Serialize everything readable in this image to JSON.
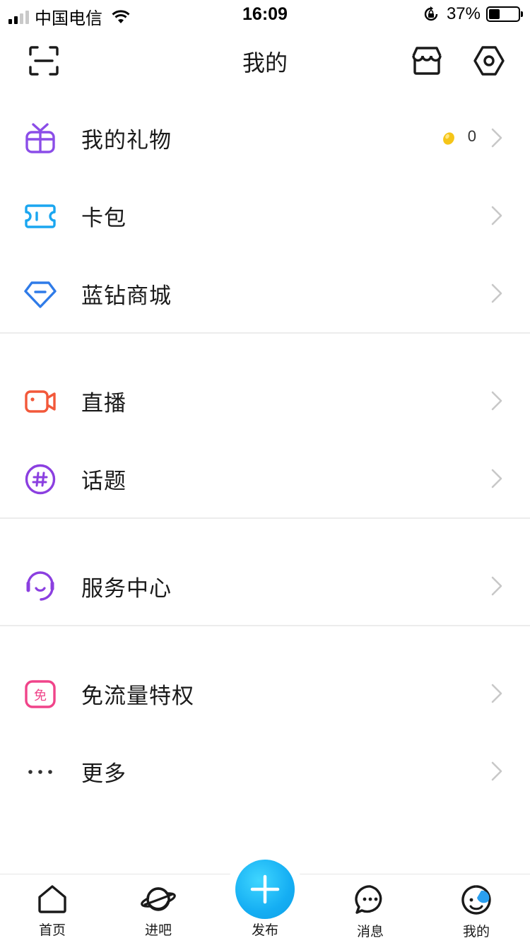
{
  "status_bar": {
    "carrier": "中国电信",
    "time": "16:09",
    "battery": "37%",
    "battery_level": 0.37
  },
  "header": {
    "title": "我的",
    "icons": [
      "scan-icon",
      "shop-icon",
      "settings-icon"
    ]
  },
  "menu": {
    "groups": [
      [
        {
          "label": "我的礼物",
          "icon": "gift-icon",
          "count": "0"
        },
        {
          "label": "卡包",
          "icon": "ticket-icon"
        },
        {
          "label": "蓝钻商城",
          "icon": "diamond-icon"
        }
      ],
      [
        {
          "label": "直播",
          "icon": "video-camera-icon"
        },
        {
          "label": "话题",
          "icon": "hashtag-icon"
        }
      ],
      [
        {
          "label": "服务中心",
          "icon": "headset-icon"
        }
      ],
      [
        {
          "label": "免流量特权",
          "icon": "free-data-icon",
          "badge": "免"
        },
        {
          "label": "更多",
          "icon": "more-dots-icon"
        }
      ]
    ]
  },
  "tabbar": {
    "home": "首页",
    "bars": "进吧",
    "publish": "发布",
    "messages": "消息",
    "mine": "我的"
  },
  "colors": {
    "gift": "#8b4de8",
    "ticket": "#1aa6f0",
    "diamond": "#2f7be8",
    "live": "#f2583a",
    "topic": "#8b3fe0",
    "service": "#8b3fe0",
    "free": "#f0448a",
    "publish": "#15aef3"
  }
}
